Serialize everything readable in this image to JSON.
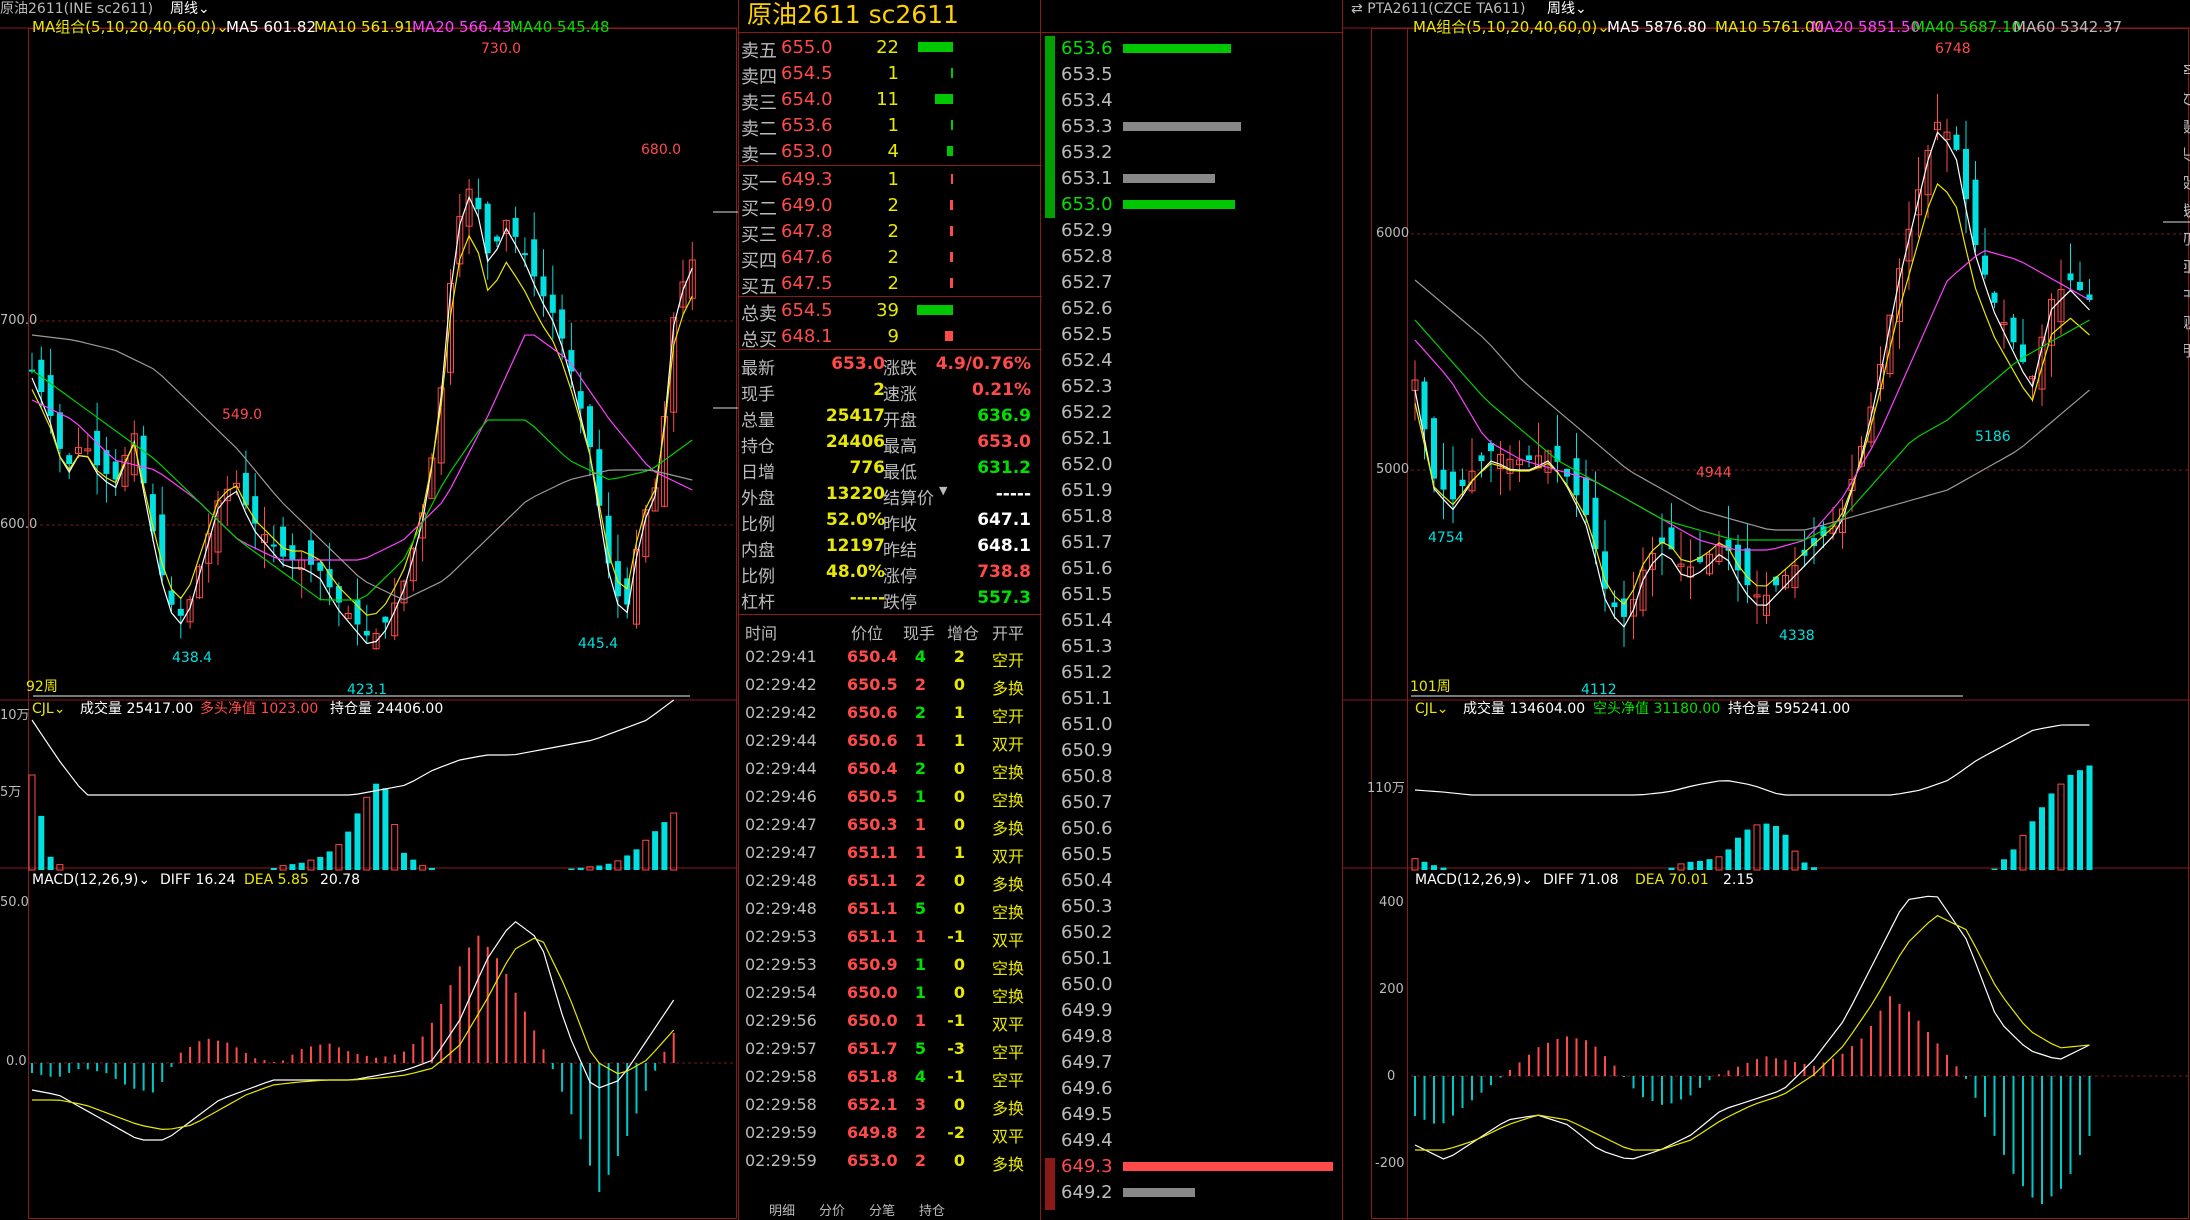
{
  "left": {
    "header_symbol": "原油2611(INE sc2611)",
    "header_period": "周线",
    "ma_group": "MA组合(5,10,20,40,60,0)",
    "ma5": "MA5 601.82",
    "ma10": "MA10 561.91",
    "ma20": "MA20 566.43",
    "ma40": "MA40 545.48",
    "price_labels": {
      "p730": "730.0",
      "p680": "680.0",
      "p549": "549.0",
      "p438": "438.4",
      "p423": "423.1",
      "p445": "445.4"
    },
    "axis": {
      "a700": "700.0",
      "a600": "600.0"
    },
    "weeks": "92周",
    "vol_header": "CJL",
    "vol_amount": "成交量 25417.00",
    "vol_net": "多头净值 1023.00",
    "vol_oi": "持仓量 24406.00",
    "vol_axis": {
      "v10": "10万",
      "v5": "5万"
    },
    "macd_header": "MACD(12,26,9)",
    "macd_diff": "DIFF 16.24",
    "macd_dea": "DEA 5.85",
    "macd_val": "20.78",
    "macd_axis": {
      "m50": "50.0",
      "m0": "0.0"
    }
  },
  "quote": {
    "title": "原油2611  sc2611",
    "asks": [
      {
        "label": "卖五",
        "price": "655.0",
        "vol": "22"
      },
      {
        "label": "卖四",
        "price": "654.5",
        "vol": "1"
      },
      {
        "label": "卖三",
        "price": "654.0",
        "vol": "11"
      },
      {
        "label": "卖二",
        "price": "653.6",
        "vol": "1"
      },
      {
        "label": "卖一",
        "price": "653.0",
        "vol": "4"
      }
    ],
    "bids": [
      {
        "label": "买一",
        "price": "649.3",
        "vol": "1"
      },
      {
        "label": "买二",
        "price": "649.0",
        "vol": "2"
      },
      {
        "label": "买三",
        "price": "647.8",
        "vol": "2"
      },
      {
        "label": "买四",
        "price": "647.6",
        "vol": "2"
      },
      {
        "label": "买五",
        "price": "647.5",
        "vol": "2"
      }
    ],
    "totals": [
      {
        "label": "总卖",
        "price": "654.5",
        "vol": "39"
      },
      {
        "label": "总买",
        "price": "648.1",
        "vol": "9"
      }
    ],
    "stats_left": [
      {
        "k": "最新",
        "v": "653.0"
      },
      {
        "k": "现手",
        "v": "2"
      },
      {
        "k": "总量",
        "v": "25417"
      },
      {
        "k": "持仓",
        "v": "24406"
      },
      {
        "k": "日增",
        "v": "776"
      },
      {
        "k": "外盘",
        "v": "13220"
      },
      {
        "k": "比例",
        "v": "52.0%"
      },
      {
        "k": "内盘",
        "v": "12197"
      },
      {
        "k": "比例",
        "v": "48.0%"
      },
      {
        "k": "杠杆",
        "v": "-----"
      }
    ],
    "stats_right": [
      {
        "k": "涨跌",
        "v": "4.9/0.76%"
      },
      {
        "k": "速涨",
        "v": "0.21%"
      },
      {
        "k": "开盘",
        "v": "636.9"
      },
      {
        "k": "最高",
        "v": "653.0"
      },
      {
        "k": "最低",
        "v": "631.2"
      },
      {
        "k": "结算价",
        "v": "-----"
      },
      {
        "k": "昨收",
        "v": "647.1"
      },
      {
        "k": "昨结",
        "v": "648.1"
      },
      {
        "k": "涨停",
        "v": "738.8"
      },
      {
        "k": "跌停",
        "v": "557.3"
      }
    ],
    "tick_headers": [
      "时间",
      "价位",
      "现手",
      "增仓",
      "开平"
    ],
    "ticks": [
      [
        "02:29:41",
        "650.4",
        "4",
        "2",
        "空开"
      ],
      [
        "02:29:42",
        "650.5",
        "2",
        "0",
        "多换"
      ],
      [
        "02:29:42",
        "650.6",
        "2",
        "1",
        "空开"
      ],
      [
        "02:29:44",
        "650.6",
        "1",
        "1",
        "双开"
      ],
      [
        "02:29:44",
        "650.4",
        "2",
        "0",
        "空换"
      ],
      [
        "02:29:46",
        "650.5",
        "1",
        "0",
        "空换"
      ],
      [
        "02:29:47",
        "650.3",
        "1",
        "0",
        "多换"
      ],
      [
        "02:29:47",
        "651.1",
        "1",
        "1",
        "双开"
      ],
      [
        "02:29:48",
        "651.1",
        "2",
        "0",
        "多换"
      ],
      [
        "02:29:48",
        "651.1",
        "5",
        "0",
        "空换"
      ],
      [
        "02:29:53",
        "651.1",
        "1",
        "-1",
        "双平"
      ],
      [
        "02:29:53",
        "650.9",
        "1",
        "0",
        "空换"
      ],
      [
        "02:29:54",
        "650.0",
        "1",
        "0",
        "空换"
      ],
      [
        "02:29:56",
        "650.0",
        "1",
        "-1",
        "双平"
      ],
      [
        "02:29:57",
        "651.7",
        "5",
        "-3",
        "空平"
      ],
      [
        "02:29:58",
        "651.8",
        "4",
        "-1",
        "空平"
      ],
      [
        "02:29:58",
        "652.1",
        "3",
        "0",
        "多换"
      ],
      [
        "02:29:59",
        "649.8",
        "2",
        "-2",
        "双平"
      ],
      [
        "02:29:59",
        "653.0",
        "2",
        "0",
        "多换"
      ]
    ],
    "bottom_tabs": [
      "明细",
      "分价",
      "分笔",
      "持仓"
    ]
  },
  "ladder": {
    "prices": [
      "653.6",
      "653.5",
      "653.4",
      "653.3",
      "653.2",
      "653.1",
      "653.0",
      "652.9",
      "652.8",
      "652.7",
      "652.6",
      "652.5",
      "652.4",
      "652.3",
      "652.2",
      "652.1",
      "652.0",
      "651.9",
      "651.8",
      "651.7",
      "651.6",
      "651.5",
      "651.4",
      "651.3",
      "651.2",
      "651.1",
      "651.0",
      "650.9",
      "650.8",
      "650.7",
      "650.6",
      "650.5",
      "650.4",
      "650.3",
      "650.2",
      "650.1",
      "650.0",
      "649.9",
      "649.8",
      "649.7",
      "649.6",
      "649.5",
      "649.4",
      "649.3",
      "649.2"
    ]
  },
  "right": {
    "header_symbol": "PTA2611(CZCE TA611)",
    "header_period": "周线",
    "ma_group": "MA组合(5,10,20,40,60,0)",
    "ma5": "MA5 5876.80",
    "ma10": "MA10 5761.00",
    "ma20": "MA20 5851.50",
    "ma40": "MA40 5687.10",
    "ma60": "MA60 5342.37",
    "price_labels": {
      "p6748": "6748",
      "p4944": "4944",
      "p4754": "4754",
      "p5186": "5186",
      "p4338": "4338",
      "p4112": "4112"
    },
    "axis": {
      "a6000": "6000",
      "a5000": "5000"
    },
    "weeks": "101周",
    "vol_header": "CJL",
    "vol_amount": "成交量 134604.00",
    "vol_net": "空头净值 31180.00",
    "vol_oi": "持仓量 595241.00",
    "vol_axis": {
      "v110": "110万"
    },
    "macd_header": "MACD(12,26,9)",
    "macd_diff": "DIFF 71.08",
    "macd_dea": "DEA 70.01",
    "macd_val": "2.15",
    "macd_axis": {
      "m400": "400",
      "m200": "200",
      "m0": "0",
      "mneg200": "-200"
    },
    "side_chars": [
      "李",
      "文",
      "最",
      "头",
      "段",
      "线",
      "切",
      "回",
      "中",
      "规",
      "明"
    ]
  },
  "colors": {
    "up": "#ff4a4a",
    "down": "#00e0e0",
    "ma5": "#ffffff",
    "ma10": "#e8e800",
    "ma20": "#ff40ff",
    "ma40": "#00d000",
    "ma60": "#999999",
    "frame": "#8a1a1a"
  }
}
